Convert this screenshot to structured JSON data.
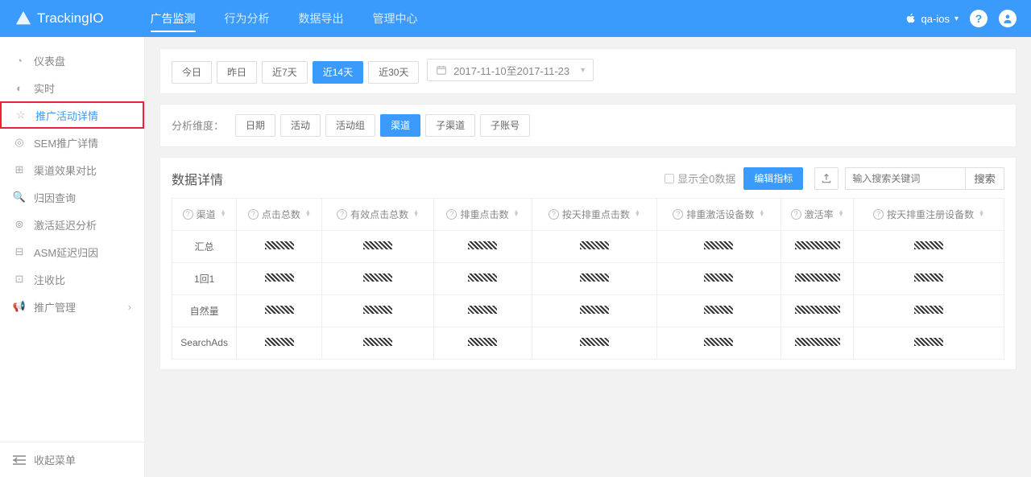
{
  "brand": "TrackingIO",
  "topnav": [
    "广告监测",
    "行为分析",
    "数据导出",
    "管理中心"
  ],
  "topnav_active": 0,
  "platform_label": "qa-ios",
  "sidebar": [
    {
      "label": "仪表盘"
    },
    {
      "label": "实时"
    },
    {
      "label": "推广活动详情",
      "highlight": true
    },
    {
      "label": "SEM推广详情"
    },
    {
      "label": "渠道效果对比"
    },
    {
      "label": "归因查询"
    },
    {
      "label": "激活延迟分析"
    },
    {
      "label": "ASM延迟归因"
    },
    {
      "label": "注收比"
    },
    {
      "label": "推广管理",
      "expandable": true
    }
  ],
  "collapse_label": "收起菜单",
  "date_quick": [
    "今日",
    "昨日",
    "近7天",
    "近14天",
    "近30天"
  ],
  "date_quick_active": 3,
  "date_range": "2017-11-10至2017-11-23",
  "dim_label": "分析维度：",
  "dims": [
    "日期",
    "活动",
    "活动组",
    "渠道",
    "子渠道",
    "子账号"
  ],
  "dims_active": 3,
  "data_title": "数据详情",
  "show_zero_label": "显示全0数据",
  "edit_metrics_label": "编辑指标",
  "search_placeholder": "输入搜索关键词",
  "search_btn": "搜索",
  "columns": [
    "渠道",
    "点击总数",
    "有效点击总数",
    "排重点击数",
    "按天排重点击数",
    "排重激活设备数",
    "激活率",
    "按天排重注册设备数"
  ],
  "rows": [
    "汇总",
    "1回1",
    "自然量",
    "SearchAds"
  ]
}
